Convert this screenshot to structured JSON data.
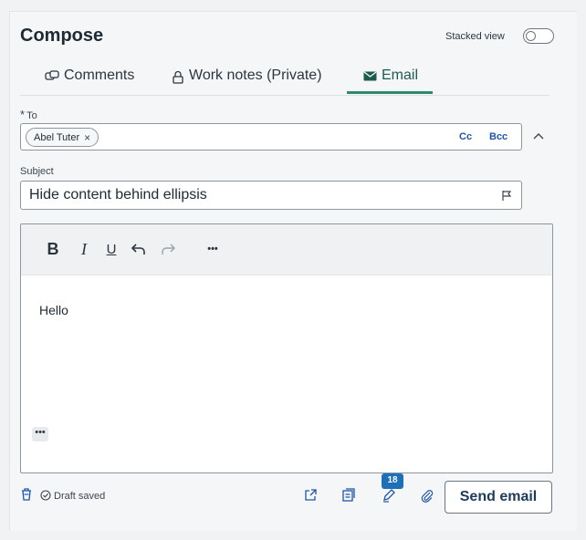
{
  "compose": {
    "title": "Compose",
    "stacked_view_label": "Stacked view",
    "stacked_view_on": false
  },
  "tabs": [
    {
      "label": "Comments",
      "icon": "comments-icon",
      "active": false
    },
    {
      "label": "Work notes (Private)",
      "icon": "lock-icon",
      "active": false
    },
    {
      "label": "Email",
      "icon": "envelope-icon",
      "active": true
    }
  ],
  "to": {
    "label": "To",
    "required_marker": "*",
    "recipients": [
      {
        "name": "Abel Tuter",
        "remove": "×"
      }
    ],
    "cc_label": "Cc",
    "bcc_label": "Bcc"
  },
  "subject": {
    "label": "Subject",
    "value": "Hide content behind ellipsis"
  },
  "editor": {
    "toolbar": {
      "bold": "B",
      "italic": "I",
      "underline": "U",
      "more": "•••"
    },
    "body": "Hello",
    "more_small": "•••"
  },
  "footer": {
    "draft_status": "Draft saved",
    "badge_count": "18",
    "send_label": "Send email"
  },
  "colors": {
    "accent": "#2e8b6a",
    "link": "#1e55a8",
    "badge": "#1d6fb8"
  }
}
